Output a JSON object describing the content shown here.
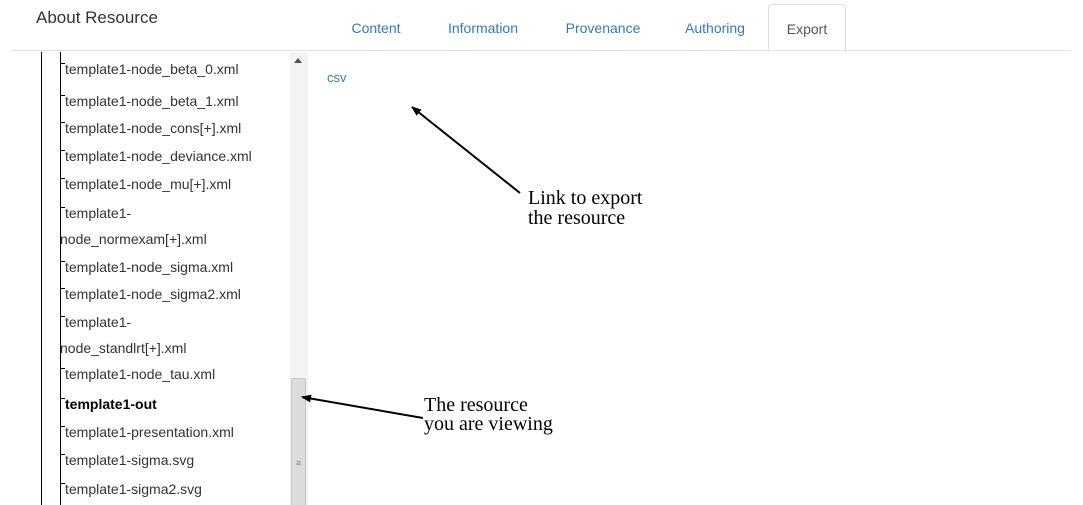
{
  "header": {
    "title": "About Resource"
  },
  "tabs": [
    {
      "label": "Content"
    },
    {
      "label": "Information"
    },
    {
      "label": "Provenance"
    },
    {
      "label": "Authoring"
    },
    {
      "label": "Export",
      "active": true
    }
  ],
  "tree": {
    "items": [
      {
        "label": "template1-node_beta_0.xml"
      },
      {
        "label": "template1-node_beta_1.xml"
      },
      {
        "label": "template1-node_cons[+].xml"
      },
      {
        "label": "template1-node_deviance.xml"
      },
      {
        "label": "template1-node_mu[+].xml"
      },
      {
        "label": "template1-node_normexam[+].xml"
      },
      {
        "label": "template1-node_sigma.xml"
      },
      {
        "label": "template1-node_sigma2.xml"
      },
      {
        "label": "template1-node_standlrt[+].xml"
      },
      {
        "label": "template1-node_tau.xml"
      },
      {
        "label": "template1-out",
        "selected": true
      },
      {
        "label": "template1-presentation.xml"
      },
      {
        "label": "template1-sigma.svg"
      },
      {
        "label": "template1-sigma2.svg"
      }
    ]
  },
  "export": {
    "link_label": "csv"
  },
  "annotations": {
    "export_note_line1": "Link to export",
    "export_note_line2": "the resource",
    "viewing_note_line1": "The resource",
    "viewing_note_line2": "you are viewing"
  },
  "colors": {
    "link": "#337ab7",
    "text": "#333333"
  }
}
